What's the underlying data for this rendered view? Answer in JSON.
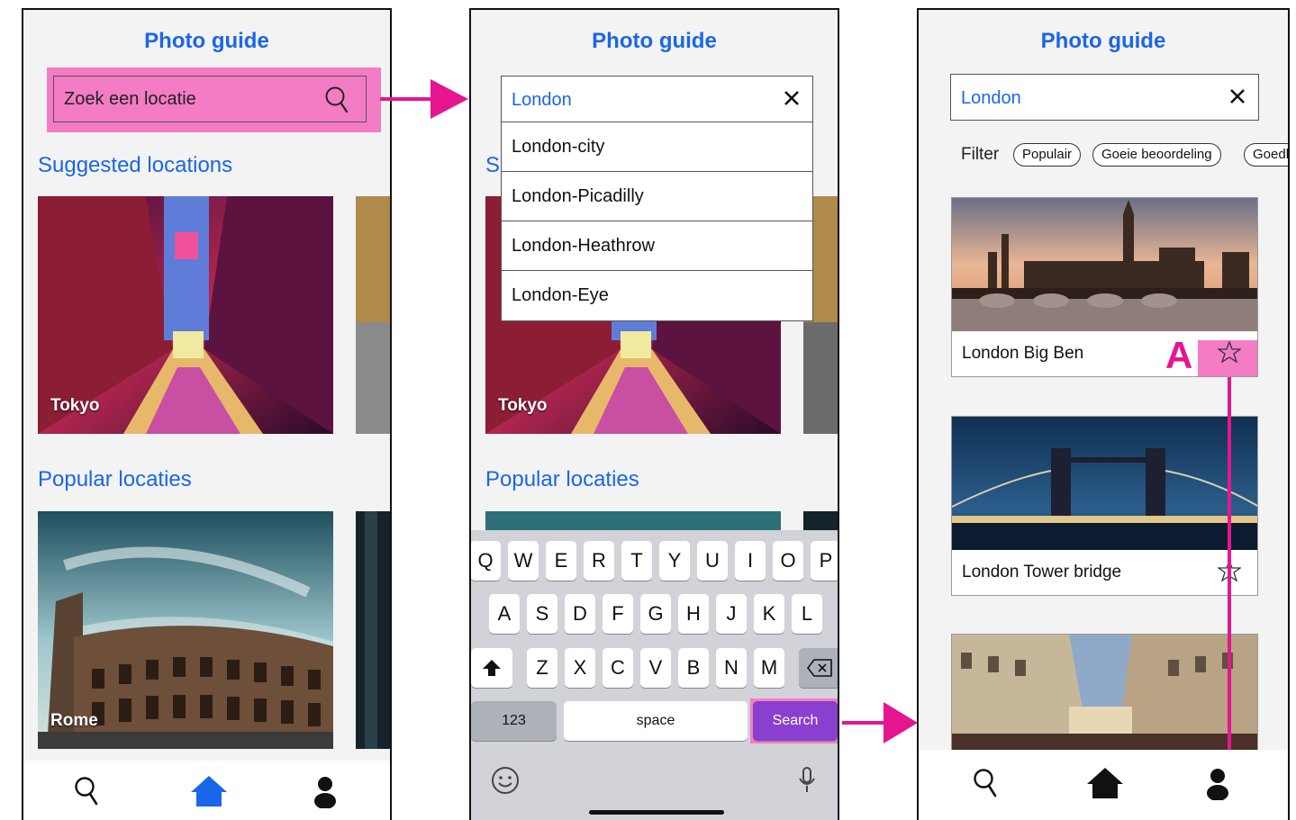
{
  "app": {
    "title": "Photo guide"
  },
  "screen1": {
    "search_placeholder": "Zoek een locatie",
    "suggested_heading": "Suggested locations",
    "popular_heading": "Popular locaties",
    "cards": [
      {
        "label": "Tokyo"
      },
      {
        "label": "Rome"
      }
    ]
  },
  "screen2": {
    "search_value": "London",
    "suggestions": [
      "London-city",
      "London-Picadilly",
      "London-Heathrow",
      "London-Eye"
    ],
    "suggested_heading_partial": "S",
    "popular_heading": "Popular locaties",
    "card_label": "Tokyo",
    "keyboard": {
      "row1": [
        "Q",
        "W",
        "E",
        "R",
        "T",
        "Y",
        "U",
        "I",
        "O",
        "P"
      ],
      "row2": [
        "A",
        "S",
        "D",
        "F",
        "G",
        "H",
        "J",
        "K",
        "L"
      ],
      "row3": [
        "Z",
        "X",
        "C",
        "V",
        "B",
        "N",
        "M"
      ],
      "numbers_key": "123",
      "space_key": "space",
      "search_key": "Search"
    }
  },
  "screen3": {
    "search_value": "London",
    "filter_label": "Filter",
    "filters": [
      "Populair",
      "Goeie beoordeling",
      "Goedl"
    ],
    "results": [
      {
        "name": "London Big Ben"
      },
      {
        "name": "London Tower bridge"
      }
    ],
    "annotation_marker": "A"
  },
  "colors": {
    "accent": "#1a66e8",
    "highlight": "#f47cc4",
    "arrow": "#e5168f",
    "search_key": "#8a3fd1"
  }
}
